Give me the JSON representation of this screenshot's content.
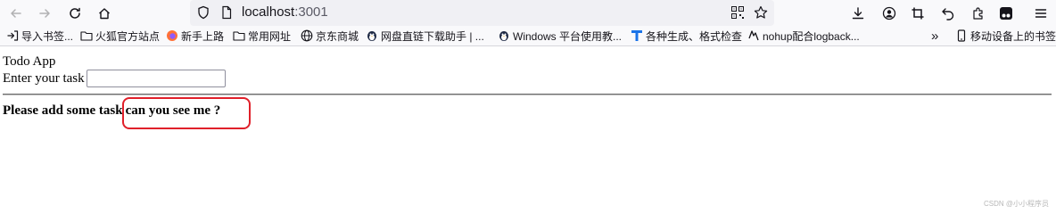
{
  "browser": {
    "url_host": "localhost",
    "url_port": ":3001",
    "bookmarks": [
      {
        "label": "导入书签...",
        "icon": "import-icon"
      },
      {
        "label": "火狐官方站点",
        "icon": "folder-icon"
      },
      {
        "label": "新手上路",
        "icon": "firefox-icon"
      },
      {
        "label": "常用网址",
        "icon": "folder-icon"
      },
      {
        "label": "京东商城",
        "icon": "globe-icon"
      },
      {
        "label": "网盘直链下载助手 | ...",
        "icon": "penguin-icon"
      },
      {
        "label": "Windows 平台使用教...",
        "icon": "penguin-icon"
      },
      {
        "label": "各种生成、格式检查",
        "icon": "t-icon"
      },
      {
        "label": "nohup配合logback...",
        "icon": "link-icon"
      }
    ],
    "mobile_bookmarks": "移动设备上的书签",
    "overflow_glyph": "»"
  },
  "app": {
    "title": "Todo App",
    "input_label": "Enter your task",
    "input_value": "",
    "message": "Please add some task",
    "message_extra": "can you see me ?"
  },
  "watermark": "CSDN @小小程序员",
  "colors": {
    "annotation": "#e0202a",
    "toolbar_bg": "#f9f9fb",
    "urlbar_bg": "#f0f0f4"
  }
}
